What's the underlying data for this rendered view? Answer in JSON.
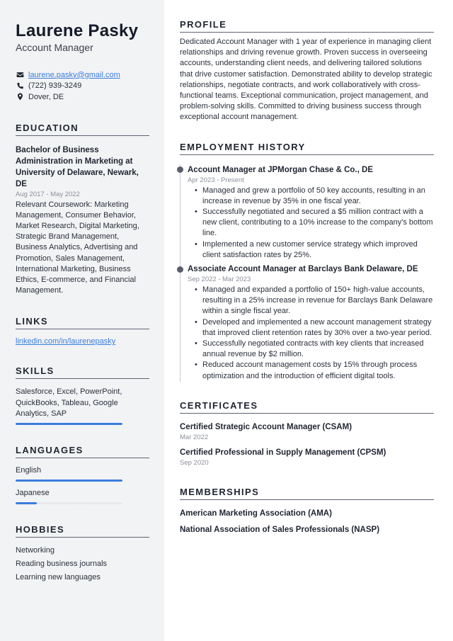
{
  "header": {
    "name": "Laurene Pasky",
    "title": "Account Manager"
  },
  "contact": {
    "email": "laurene.pasky@gmail.com",
    "phone": "(722) 939-3249",
    "location": "Dover, DE",
    "icons": [
      "envelope-icon",
      "phone-icon",
      "map-pin-icon"
    ]
  },
  "education": {
    "heading": "EDUCATION",
    "degree": "Bachelor of Business Administration in Marketing at University of Delaware, Newark, DE",
    "dates": "Aug 2017 - May 2022",
    "description": "Relevant Coursework: Marketing Management, Consumer Behavior, Market Research, Digital Marketing, Strategic Brand Management, Business Analytics, Advertising and Promotion, Sales Management, International Marketing, Business Ethics, E-commerce, and Financial Management."
  },
  "links": {
    "heading": "LINKS",
    "items": [
      "linkedin.com/in/laurenepasky"
    ]
  },
  "skills": {
    "heading": "SKILLS",
    "text": "Salesforce, Excel, PowerPoint, QuickBooks, Tableau, Google Analytics, SAP",
    "level_percent": 100
  },
  "languages": {
    "heading": "LANGUAGES",
    "items": [
      {
        "label": "English",
        "level_percent": 100
      },
      {
        "label": "Japanese",
        "level_percent": 20
      }
    ]
  },
  "hobbies": {
    "heading": "HOBBIES",
    "items": [
      "Networking",
      "Reading business journals",
      "Learning new languages"
    ]
  },
  "profile": {
    "heading": "PROFILE",
    "text": "Dedicated Account Manager with 1 year of experience in managing client relationships and driving revenue growth. Proven success in overseeing accounts, understanding client needs, and delivering tailored solutions that drive customer satisfaction. Demonstrated ability to develop strategic relationships, negotiate contracts, and work collaboratively with cross-functional teams. Exceptional communication, project management, and problem-solving skills. Committed to driving business success through exceptional account management."
  },
  "employment": {
    "heading": "EMPLOYMENT HISTORY",
    "jobs": [
      {
        "title": "Account Manager at JPMorgan Chase & Co., DE",
        "dates": "Apr 2023 - Present",
        "bullets": [
          "Managed and grew a portfolio of 50 key accounts, resulting in an increase in revenue by 35% in one fiscal year.",
          "Successfully negotiated and secured a $5 million contract with a new client, contributing to a 10% increase to the company's bottom line.",
          "Implemented a new customer service strategy which improved client satisfaction rates by 25%."
        ]
      },
      {
        "title": "Associate Account Manager at Barclays Bank Delaware, DE",
        "dates": "Sep 2022 - Mar 2023",
        "bullets": [
          "Managed and expanded a portfolio of 150+ high-value accounts, resulting in a 25% increase in revenue for Barclays Bank Delaware within a single fiscal year.",
          "Developed and implemented a new account management strategy that improved client retention rates by 30% over a two-year period.",
          "Successfully negotiated contracts with key clients that increased annual revenue by $2 million.",
          "Reduced account management costs by 15% through process optimization and the introduction of efficient digital tools."
        ]
      }
    ]
  },
  "certificates": {
    "heading": "CERTIFICATES",
    "items": [
      {
        "name": "Certified Strategic Account Manager (CSAM)",
        "date": "Mar 2022"
      },
      {
        "name": "Certified Professional in Supply Management (CPSM)",
        "date": "Sep 2020"
      }
    ]
  },
  "memberships": {
    "heading": "MEMBERSHIPS",
    "items": [
      "American Marketing Association (AMA)",
      "National Association of Sales Professionals (NASP)"
    ]
  },
  "colors": {
    "accent": "#3b7ddd",
    "sidebar_bg": "#f2f3f5",
    "text": "#1f2430",
    "muted": "#8a8f99"
  }
}
